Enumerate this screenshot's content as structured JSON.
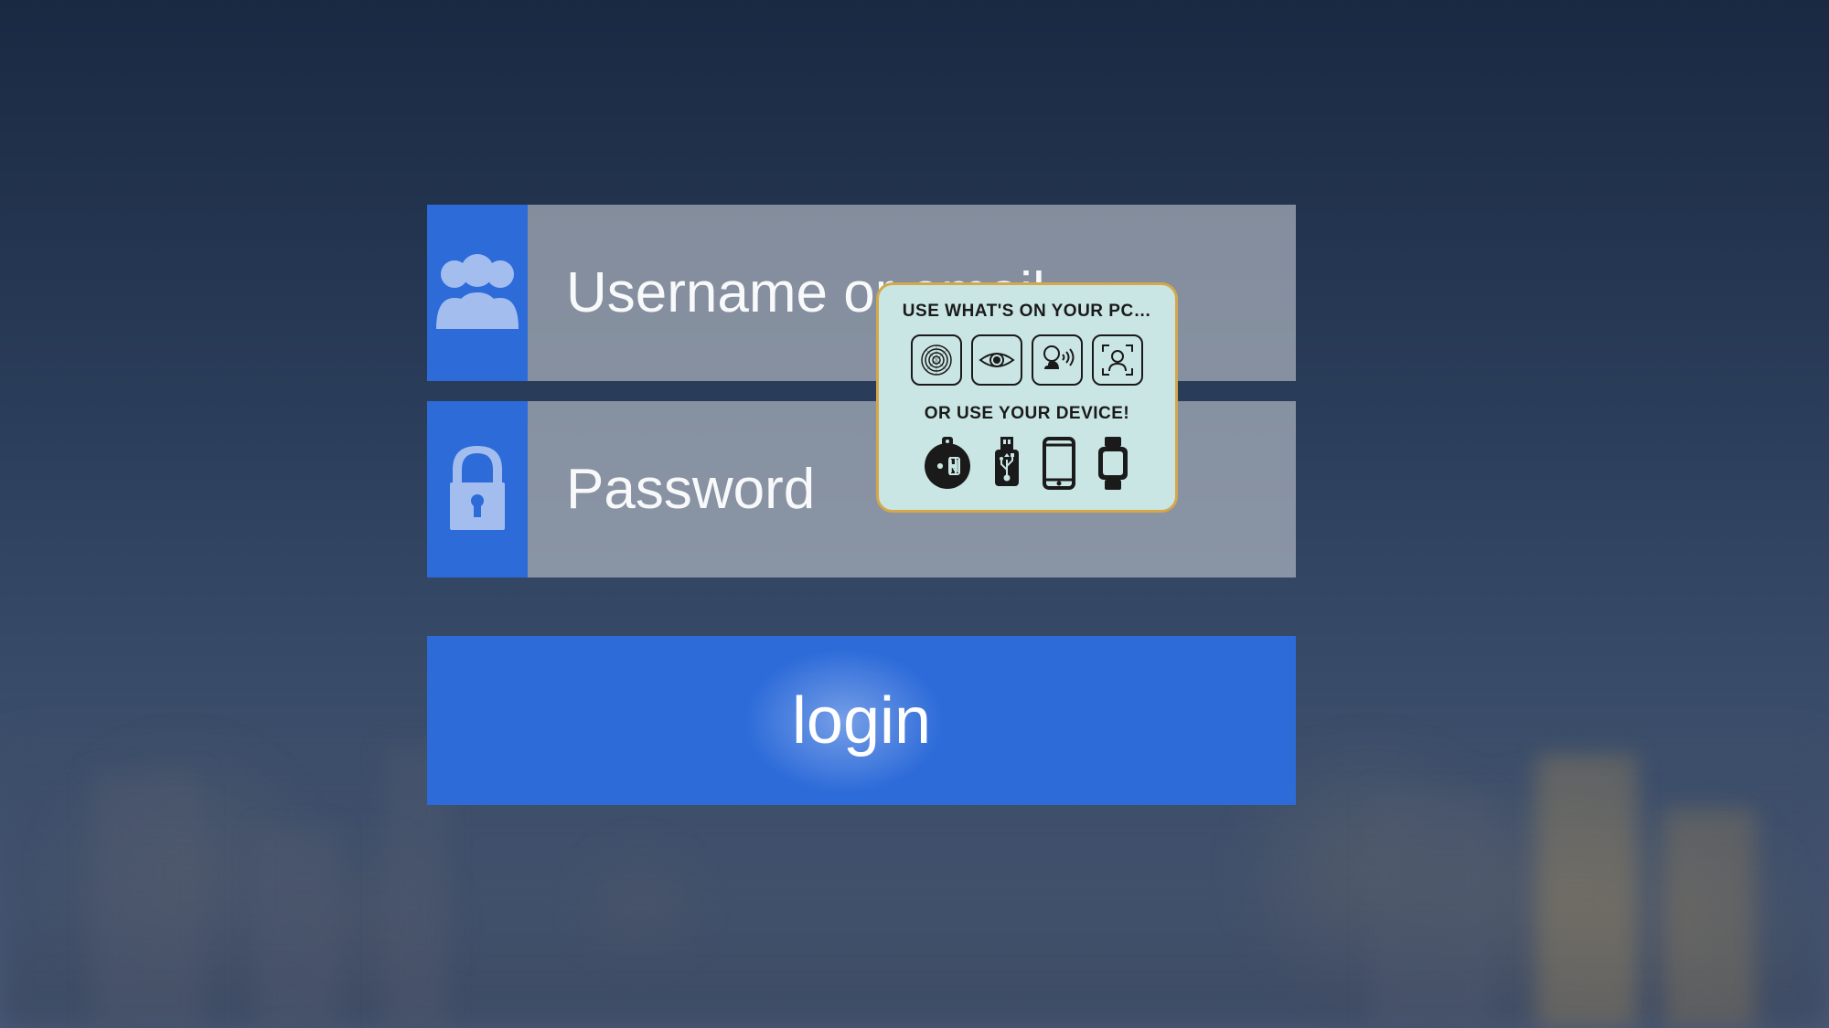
{
  "login": {
    "username_placeholder": "Username or email",
    "password_placeholder": "Password",
    "button_label": "login"
  },
  "popup": {
    "heading_pc": "USE WHAT'S ON YOUR PC…",
    "heading_device": "OR USE YOUR DEVICE!",
    "pc_icons": [
      "fingerprint",
      "eye",
      "voice",
      "face"
    ],
    "device_icons": [
      "nfc-tag",
      "usb-drive",
      "smartphone",
      "smartwatch"
    ]
  },
  "colors": {
    "primary_blue": "#2d6bd9",
    "popup_bg": "#cae6e4",
    "popup_border": "#d4a84a"
  }
}
